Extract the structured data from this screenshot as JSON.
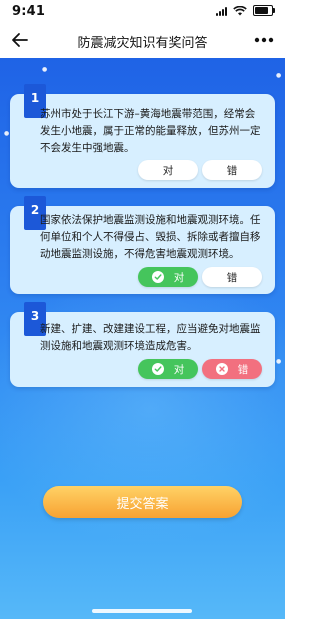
{
  "status_bar": {
    "time": "9:41"
  },
  "header": {
    "title": "防震减灾知识有奖问答"
  },
  "questions": [
    {
      "number": "1",
      "text": "苏州市处于长江下游–黄海地震带范围，经常会发生小地震，属于正常的能量释放，但苏州一定不会发生中强地震。",
      "true_label": "对",
      "false_label": "错",
      "selected": "none"
    },
    {
      "number": "2",
      "text": "国家依法保护地震监测设施和地震观测环境。任何单位和个人不得侵占、毁损、拆除或者擅自移动地震监测设施，不得危害地震观测环境。",
      "true_label": "对",
      "false_label": "错",
      "selected": "true"
    },
    {
      "number": "3",
      "text": "新建、扩建、改建建设工程，应当避免对地震监测设施和地震观测环境造成危害。",
      "true_label": "对",
      "false_label": "错",
      "selected": "both"
    }
  ],
  "submit_label": "提交答案",
  "colors": {
    "primary_blue": "#1f63e6",
    "card_bg": "#d7efff",
    "correct_green": "#45c55c",
    "wrong_red": "#f2707f",
    "submit_orange": "#f7a232"
  }
}
